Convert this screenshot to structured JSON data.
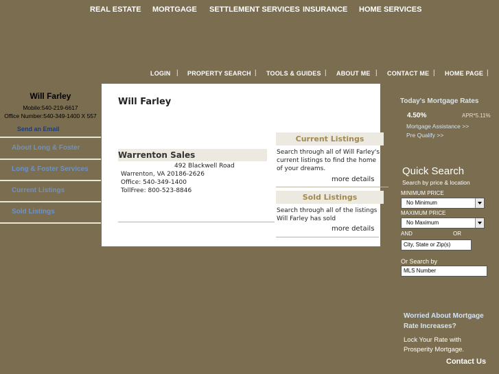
{
  "top_nav": [
    "REAL ESTATE",
    "MORTGAGE",
    "SETTLEMENT SERVICES",
    "INSURANCE",
    "HOME SERVICES"
  ],
  "secondary_nav": [
    "LOGIN",
    "PROPERTY SEARCH",
    "TOOLS & GUIDES",
    "ABOUT ME",
    "CONTACT ME",
    "HOME PAGE"
  ],
  "separator": "|",
  "agent": {
    "name": "Will Farley",
    "mobile": "Mobile:540-219-6617",
    "office": "Office Number:540-349-1400 X 557",
    "send_email": "Send an Email"
  },
  "sidebar_links": [
    "About Long & Foster",
    "Long & Foster Services",
    "Current Listings",
    "Sold Listings"
  ],
  "main": {
    "title": "Will Farley",
    "office": {
      "name": "Warrenton Sales",
      "street": "492 Blackwell Road",
      "city": "Warrenton, VA 20186-2626",
      "phone": "Office: 540-349-1400",
      "tollfree": "TollFree: 800-523-8846"
    },
    "current_listings": {
      "heading": "Current Listings",
      "description": "Search through all of Will Farley's current listings to find the home of your dreams.",
      "more": "more details"
    },
    "sold_listings": {
      "heading": "Sold Listings",
      "description": "Search through all of the listings Will Farley has sold",
      "more": "more details"
    }
  },
  "mortgage": {
    "title": "Today's Mortgage Rates",
    "rate": "4.50%",
    "apr": "APR*5.11%",
    "assistance_link": "Mortgage Assistance >>",
    "prequalify_link": "Pre Qualify >>"
  },
  "quick_search": {
    "title": "Quick Search",
    "subtitle": "Search by price & location",
    "min_label": "MINIMUM PRICE",
    "min_value": "No Minimum",
    "max_label": "MAXIMUM PRICE",
    "max_value": "No Maximum",
    "and_label": "AND",
    "or_label": "OR",
    "location_placeholder": "City, State or Zip(s)",
    "or_search_label": "Or Search by",
    "mls_placeholder": "MLS Number"
  },
  "promo": {
    "worried_line1": "Worried About Mortgage",
    "worried_line2": "Rate Increases?",
    "lock_line1": "Lock Your Rate with",
    "lock_line2": "Prosperity Mortgage.",
    "contact": "Contact Us"
  },
  "colors": {
    "background": "#7b6d4f",
    "panel": "#ffffff",
    "accent_gold": "#a08a4f",
    "link_blue": "#6e92c6"
  }
}
